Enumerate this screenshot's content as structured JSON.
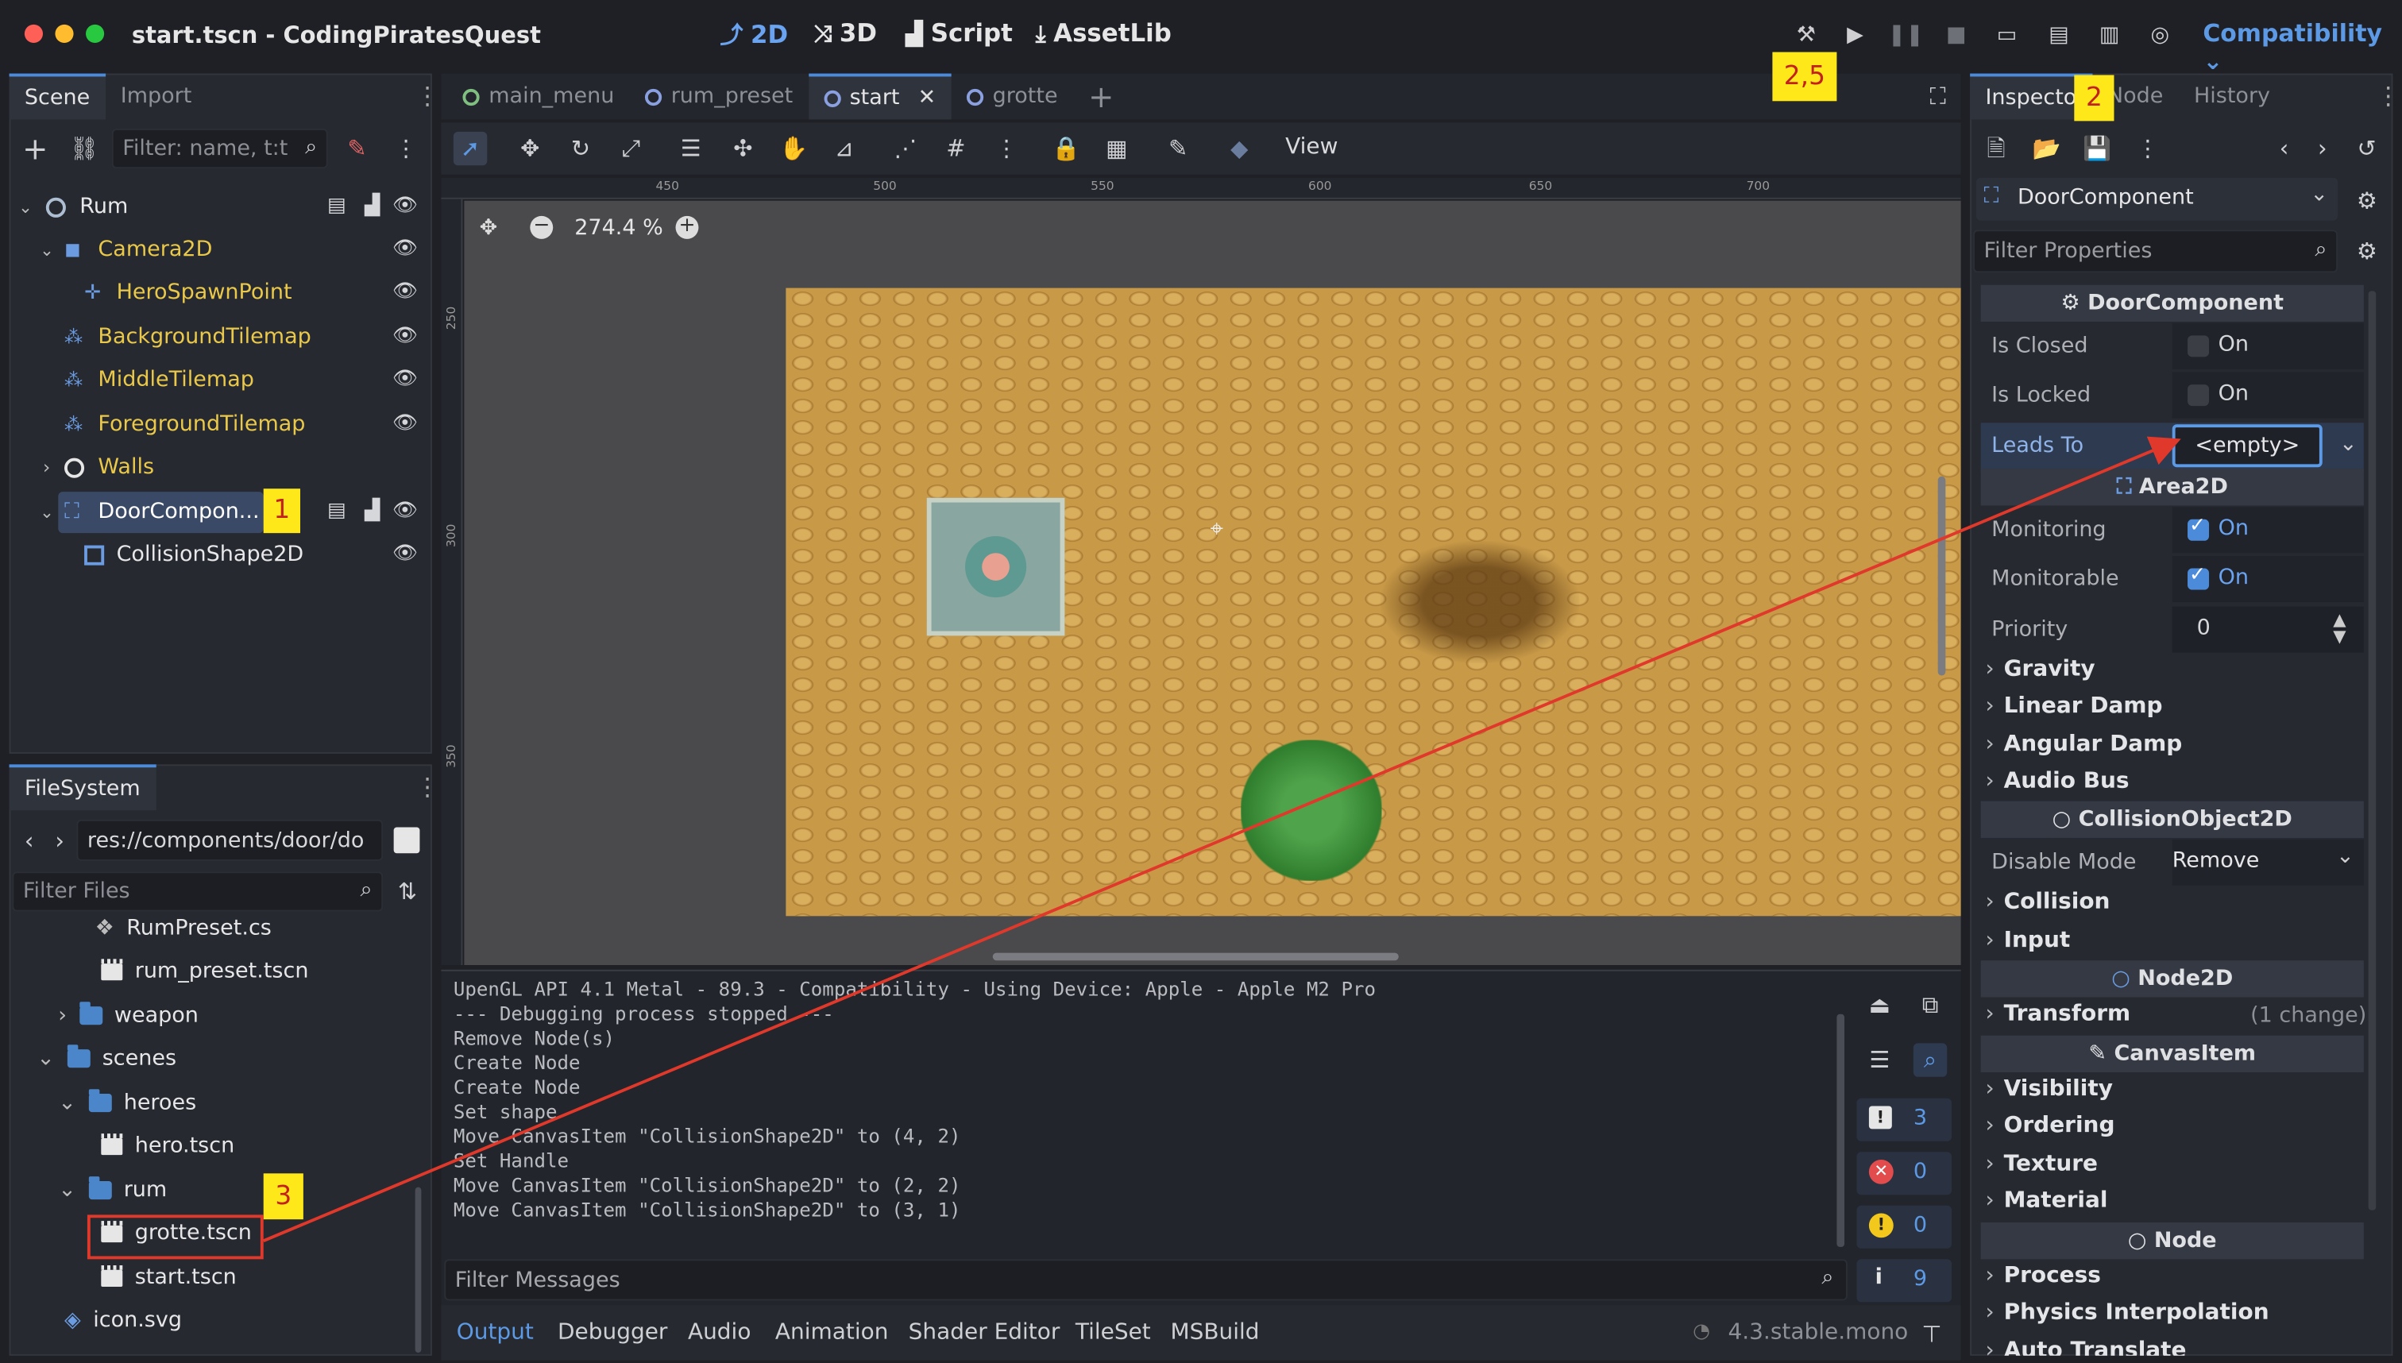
{
  "window": {
    "title": "start.tscn - CodingPiratesQuest"
  },
  "workspaces": [
    {
      "icon": "2d-icon",
      "label": "2D"
    },
    {
      "icon": "3d-icon",
      "label": "3D"
    },
    {
      "icon": "script-icon",
      "label": "Script"
    },
    {
      "icon": "assetlib-icon",
      "label": "AssetLib"
    }
  ],
  "renderer": "Compatibility",
  "scene_dock": {
    "tabs": [
      "Scene",
      "Import"
    ],
    "filter_placeholder": "Filter: name, t:t",
    "nodes": [
      {
        "label": "Rum"
      },
      {
        "label": "Camera2D"
      },
      {
        "label": "HeroSpawnPoint"
      },
      {
        "label": "BackgroundTilemap"
      },
      {
        "label": "MiddleTilemap"
      },
      {
        "label": "ForegroundTilemap"
      },
      {
        "label": "Walls"
      },
      {
        "label": "DoorCompon..."
      },
      {
        "label": "CollisionShape2D"
      }
    ]
  },
  "filesystem": {
    "tab": "FileSystem",
    "path": "res://components/door/do",
    "filter_placeholder": "Filter Files",
    "items": [
      "RumPreset.cs",
      "rum_preset.tscn",
      "weapon",
      "scenes",
      "heroes",
      "hero.tscn",
      "rum",
      "grotte.tscn",
      "start.tscn",
      "icon.svg"
    ]
  },
  "editor_tabs": [
    "main_menu",
    "rum_preset",
    "start",
    "grotte"
  ],
  "viewport": {
    "view_menu": "View",
    "zoom": "274.4 %",
    "ruler_h": [
      "450",
      "500",
      "550",
      "600",
      "650",
      "700"
    ],
    "ruler_v": [
      "250",
      "300",
      "350"
    ]
  },
  "output": {
    "lines": [
      "UpenGL API 4.1 Metal - 89.3 - Compatibility - Using Device: Apple - Apple M2 Pro",
      "",
      "--- Debugging process stopped ---",
      "Remove Node(s)",
      "Create Node",
      "Create Node",
      "Set shape",
      "Move CanvasItem \"CollisionShape2D\" to (4, 2)",
      "Set Handle",
      "Move CanvasItem \"CollisionShape2D\" to (2, 2)",
      "Move CanvasItem \"CollisionShape2D\" to (3, 1)"
    ],
    "filter_placeholder": "Filter Messages",
    "counts": {
      "messages": "3",
      "errors": "0",
      "warnings": "0",
      "info": "9"
    }
  },
  "bottom_tabs": [
    "Output",
    "Debugger",
    "Audio",
    "Animation",
    "Shader Editor",
    "TileSet",
    "MSBuild"
  ],
  "version": "4.3.stable.mono",
  "inspector": {
    "tabs": [
      "Inspecto",
      "Node",
      "History"
    ],
    "object": "DoorComponent",
    "filter_placeholder": "Filter Properties",
    "sections": {
      "door": "DoorComponent",
      "area": "Area2D",
      "collision_object": "CollisionObject2D",
      "node2d": "Node2D",
      "canvas_item": "CanvasItem",
      "node": "Node"
    },
    "props": {
      "is_closed": {
        "label": "Is Closed",
        "value": "On",
        "checked": false
      },
      "is_locked": {
        "label": "Is Locked",
        "value": "On",
        "checked": false
      },
      "leads_to": {
        "label": "Leads To",
        "value": "<empty>"
      },
      "monitoring": {
        "label": "Monitoring",
        "value": "On",
        "checked": true
      },
      "monitorable": {
        "label": "Monitorable",
        "value": "On",
        "checked": true
      },
      "priority": {
        "label": "Priority",
        "value": "0"
      },
      "disable_mode": {
        "label": "Disable Mode",
        "value": "Remove"
      }
    },
    "groups": {
      "gravity": "Gravity",
      "linear_damp": "Linear Damp",
      "angular_damp": "Angular Damp",
      "audio_bus": "Audio Bus",
      "collision": "Collision",
      "input": "Input",
      "transform": "Transform",
      "transform_note": "(1 change)",
      "visibility": "Visibility",
      "ordering": "Ordering",
      "texture": "Texture",
      "material": "Material",
      "process": "Process",
      "physics_interpolation": "Physics Interpolation",
      "auto_translate": "Auto Translate"
    }
  },
  "annotations": {
    "step1": "1",
    "step2": "2",
    "step25": "2,5",
    "step3": "3"
  },
  "colors": {
    "accent": "#4c8bd9",
    "node_yellow": "#e9c84a",
    "annotation_red": "#e0392b",
    "annotation_yellow": "#ffe81a"
  }
}
